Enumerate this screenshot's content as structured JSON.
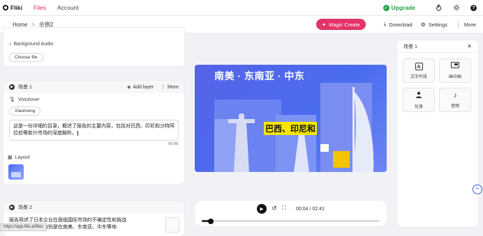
{
  "nav": {
    "brand": "Fliki",
    "files": "Files",
    "account": "Account",
    "upgrade": "Upgrade"
  },
  "subbar": {
    "home": "Home",
    "crumb_sep": ">",
    "project": "示例2",
    "magic_create": "Magic Create",
    "download": "Download",
    "settings": "Settings",
    "more": "More"
  },
  "top_card": {
    "section_label": "Background Audio",
    "choose_file": "Choose file"
  },
  "scene1": {
    "title": "场景 1",
    "add_layer": "Add layer",
    "more": "More",
    "voiceover_label": "Voiceover",
    "voice": "Xiaomeng",
    "text": "这是一份详细的目录，概述了报告的主要内容，包括对巴西、印尼和沙特阿拉伯等新兴市场的深度解析。",
    "duration": "00:08",
    "layout_label": "Layout"
  },
  "scene2": {
    "title": "场景 2",
    "text_line1": "报告简述了日本企业在面临国际市场的不确定性和挑战",
    "text_line2": "新的发展机遇，特别是在南美、东南亚、中东等地"
  },
  "video": {
    "headline": "南美 · 东南亚 · 中东",
    "caption": "巴西、印尼和"
  },
  "player": {
    "time": "00:04 / 02:41",
    "progress": 0.05
  },
  "panel": {
    "title": "场景 1",
    "tools": [
      {
        "icon": "text-A-icon",
        "label": "文字片段"
      },
      {
        "icon": "picture-in-picture-icon",
        "label": "画中画"
      },
      {
        "icon": "avatar-icon",
        "label": "化身"
      },
      {
        "icon": "music-icon",
        "label": "音频"
      }
    ]
  },
  "status_url": "https://app.fliki.ai/files",
  "colors": {
    "accent": "#e33368",
    "upgrade": "#22a447",
    "video_bg": "#4b6df0",
    "caption_bg": "#f5e400"
  }
}
